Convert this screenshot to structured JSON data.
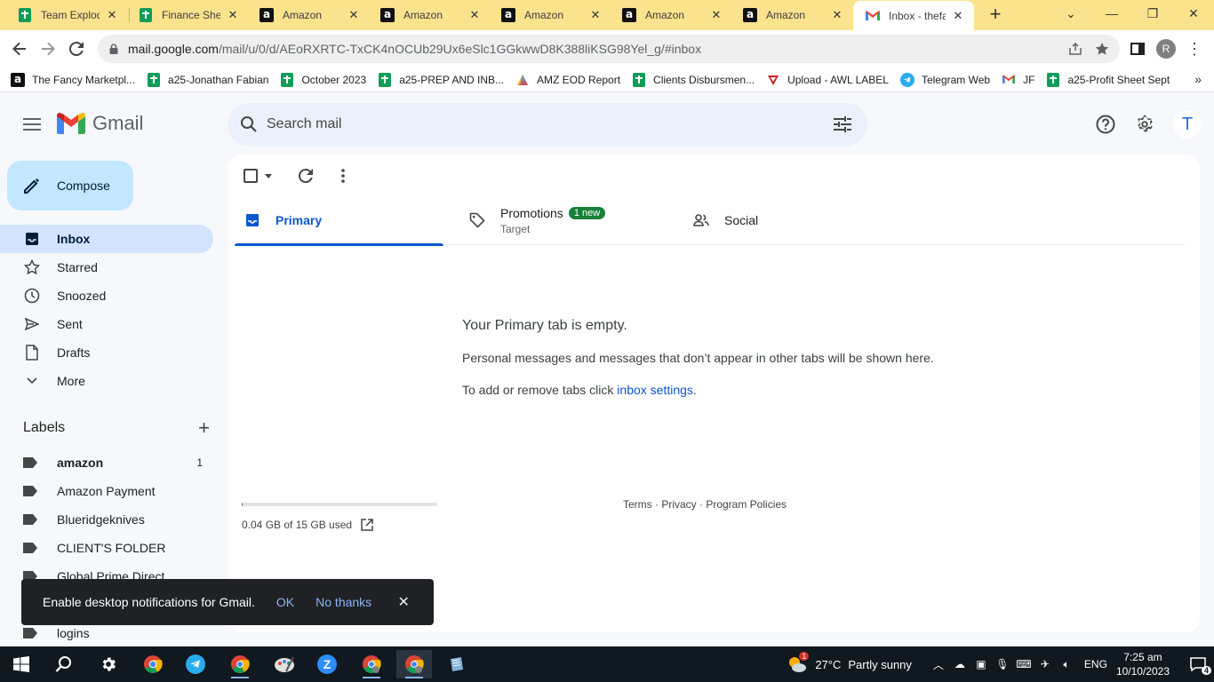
{
  "browser": {
    "tabs": [
      {
        "title": "Team Explod",
        "icon": "sheets-icon"
      },
      {
        "title": "Finance Shee",
        "icon": "sheets-icon"
      },
      {
        "title": "Amazon",
        "icon": "amazon-icon"
      },
      {
        "title": "Amazon",
        "icon": "amazon-icon"
      },
      {
        "title": "Amazon",
        "icon": "amazon-icon"
      },
      {
        "title": "Amazon",
        "icon": "amazon-icon"
      },
      {
        "title": "Amazon",
        "icon": "amazon-icon"
      },
      {
        "title": "Inbox - thefa",
        "icon": "gmail-icon"
      }
    ],
    "url_host": "mail.google.com",
    "url_path": "/mail/u/0/d/AEoRXRTC-TxCK4nOCUb29Ux6eSlc1GGkwwD8K388liKSG98Yel_g/#inbox",
    "profile_initial": "R",
    "bookmarks": [
      {
        "label": "The Fancy Marketpl...",
        "icon": "amazon-icon"
      },
      {
        "label": "a25-Jonathan Fabian",
        "icon": "sheets-icon"
      },
      {
        "label": "October 2023",
        "icon": "sheets-icon"
      },
      {
        "label": "a25-PREP AND INB...",
        "icon": "sheets-icon"
      },
      {
        "label": "AMZ EOD Report",
        "icon": "report-icon"
      },
      {
        "label": "Clients Disbursmen...",
        "icon": "sheets-icon"
      },
      {
        "label": "Upload - AWL LABEL",
        "icon": "upload-icon"
      },
      {
        "label": "Telegram Web",
        "icon": "telegram-icon"
      },
      {
        "label": "JF",
        "icon": "gmail-icon"
      },
      {
        "label": "a25-Profit Sheet Sept",
        "icon": "sheets-icon"
      }
    ],
    "bookmarks_more": "»"
  },
  "gmail": {
    "logo_text": "Gmail",
    "search_placeholder": "Search mail",
    "user_initial": "T",
    "compose_label": "Compose",
    "nav": [
      {
        "label": "Inbox",
        "icon": "inbox-icon",
        "active": true
      },
      {
        "label": "Starred",
        "icon": "star-icon"
      },
      {
        "label": "Snoozed",
        "icon": "clock-icon"
      },
      {
        "label": "Sent",
        "icon": "send-icon"
      },
      {
        "label": "Drafts",
        "icon": "draft-icon"
      },
      {
        "label": "More",
        "icon": "chevron-down-icon"
      }
    ],
    "labels_title": "Labels",
    "labels": [
      {
        "name": "amazon",
        "count": "1",
        "bold": true
      },
      {
        "name": "Amazon Payment",
        "count": ""
      },
      {
        "name": "Blueridgeknives",
        "count": ""
      },
      {
        "name": "CLIENT'S FOLDER",
        "count": ""
      },
      {
        "name": "Global Prime Direct",
        "count": ""
      },
      {
        "name": "",
        "count": ""
      },
      {
        "name": "logins",
        "count": ""
      }
    ],
    "tabs": {
      "primary": "Primary",
      "promotions": "Promotions",
      "promotions_badge": "1 new",
      "promotions_sub": "Target",
      "social": "Social"
    },
    "empty": {
      "heading": "Your Primary tab is empty.",
      "line1": "Personal messages and messages that don’t appear in other tabs will be shown here.",
      "line2_prefix": "To add or remove tabs click ",
      "line2_link": "inbox settings",
      "line2_suffix": "."
    },
    "storage": {
      "text": "0.04 GB of 15 GB used",
      "fraction": 0.003
    },
    "footer": "Terms · Privacy · Program Policies",
    "snackbar": {
      "message": "Enable desktop notifications for Gmail.",
      "ok": "OK",
      "no_thanks": "No thanks"
    }
  },
  "taskbar": {
    "weather_temp": "27°C",
    "weather_desc": "Partly sunny",
    "weather_badge": "1",
    "language": "ENG",
    "time": "7:25 am",
    "date": "10/10/2023",
    "notifications": "4"
  },
  "colors": {
    "tabstrip": "#fbe38e",
    "gmail_accent": "#0b57d0",
    "compose_bg": "#c2e7ff",
    "badge_green": "#188038"
  }
}
